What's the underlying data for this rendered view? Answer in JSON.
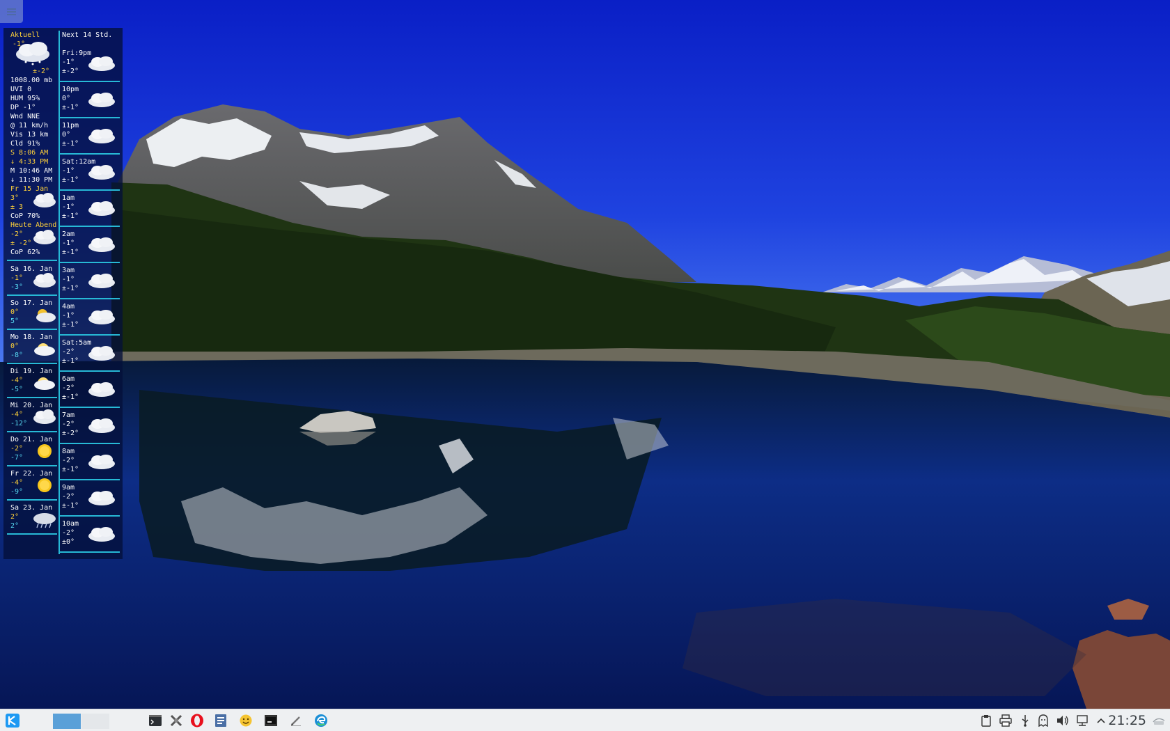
{
  "colors": {
    "accent_line": "#27b9d6",
    "highlight": "#ffd23a",
    "low": "#57d9f2",
    "taskbar": "#eef0f2"
  },
  "weather": {
    "current": {
      "header": "Aktuell",
      "temp": "-1°",
      "feels": "±-2°",
      "pressure": "1008.00 mb",
      "uvi": "UVI 0",
      "hum": "HUM 95%",
      "dp": "DP  -1°",
      "wind": "Wnd NNE",
      "wind_speed": "@ 11 km/h",
      "vis": "Vis 13 km",
      "cld": "Cld 91%",
      "sunrise": "S 8:06 AM",
      "sunset": "↓ 4:33 PM",
      "moonrise": "M 10:46 AM",
      "moonset": "↓ 11:30 PM",
      "icon": "cloud-snow-icon"
    },
    "today": {
      "label": "Fr 15 Jan",
      "high": "3°",
      "low": "± 3",
      "cop": "CoP  70%"
    },
    "evening": {
      "label": "Heute Abend",
      "high": "-2°",
      "low": "± -2°",
      "cop": "CoP  62%"
    },
    "days": [
      {
        "label": "Sa 16. Jan",
        "high": "-1°",
        "low": "-3°",
        "icon": "cloud-icon"
      },
      {
        "label": "So 17. Jan",
        "high": "0°",
        "low": "5°",
        "icon": "partly-sunny-icon"
      },
      {
        "label": "Mo 18. Jan",
        "high": "0°",
        "low": "-8°",
        "icon": "sun-cloud-icon"
      },
      {
        "label": "Di 19. Jan",
        "high": "-4°",
        "low": "-5°",
        "icon": "sun-cloud-icon"
      },
      {
        "label": "Mi 20. Jan",
        "high": "-4°",
        "low": "-12°",
        "icon": "cloud-icon"
      },
      {
        "label": "Do 21. Jan",
        "high": "-2°",
        "low": "-7°",
        "icon": "sun-icon"
      },
      {
        "label": "Fr 22. Jan",
        "high": "-4°",
        "low": "-9°",
        "icon": "sun-icon"
      },
      {
        "label": "Sa 23. Jan",
        "high": "2°",
        "low": "2°",
        "icon": "rain-cloud-icon"
      }
    ],
    "hourly_header": "Next 14 Std.",
    "hours": [
      {
        "time": "Fri:9pm",
        "temp": "-1°",
        "feels": "±-2°"
      },
      {
        "time": "10pm",
        "temp": "0°",
        "feels": "±-1°"
      },
      {
        "time": "11pm",
        "temp": "0°",
        "feels": "±-1°"
      },
      {
        "time": "Sat:12am",
        "temp": "-1°",
        "feels": "±-1°"
      },
      {
        "time": "1am",
        "temp": "-1°",
        "feels": "±-1°"
      },
      {
        "time": "2am",
        "temp": "-1°",
        "feels": "±-1°"
      },
      {
        "time": "3am",
        "temp": "-1°",
        "feels": "±-1°"
      },
      {
        "time": "4am",
        "temp": "-1°",
        "feels": "±-1°"
      },
      {
        "time": "Sat:5am",
        "temp": "-2°",
        "feels": "±-1°"
      },
      {
        "time": "6am",
        "temp": "-2°",
        "feels": "±-1°"
      },
      {
        "time": "7am",
        "temp": "-2°",
        "feels": "±-2°"
      },
      {
        "time": "8am",
        "temp": "-2°",
        "feels": "±-1°"
      },
      {
        "time": "9am",
        "temp": "-2°",
        "feels": "±-1°"
      },
      {
        "time": "10am",
        "temp": "-2°",
        "feels": "±0°"
      }
    ]
  },
  "taskbar": {
    "launcher_icon": "kde-launcher-icon",
    "quicklaunch": [
      "terminal-icon",
      "system-settings-icon",
      "opera-browser-icon",
      "text-editor-icon",
      "smiley-icon",
      "console-icon",
      "pencil-icon",
      "edge-browser-icon"
    ],
    "tray": [
      "clipboard-icon",
      "printer-icon",
      "usb-icon",
      "ghost-icon",
      "volume-icon",
      "network-icon",
      "tray-expand-icon"
    ],
    "clock": "21:25"
  }
}
